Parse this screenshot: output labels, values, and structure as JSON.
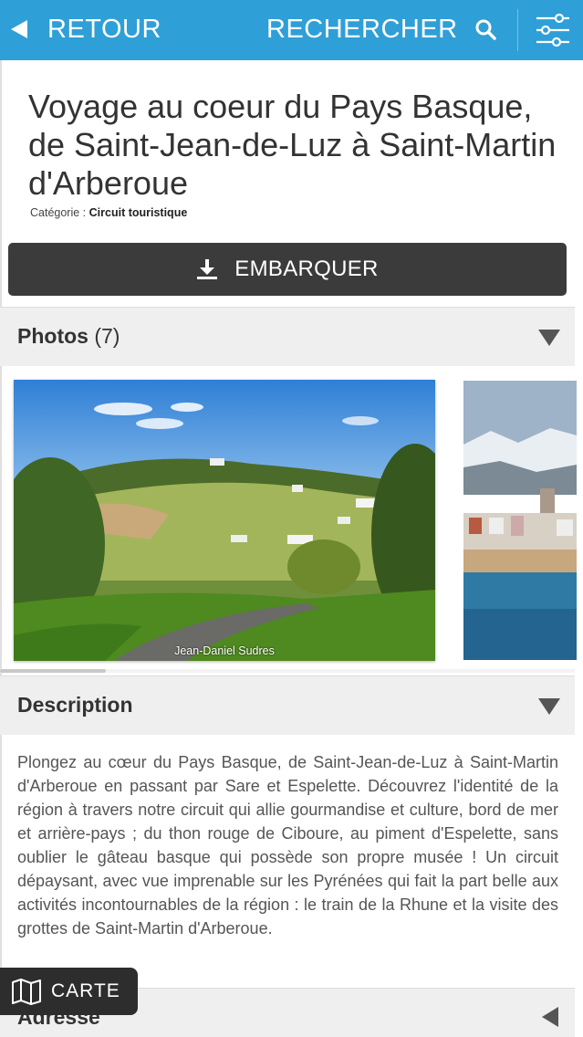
{
  "topbar": {
    "back_label": "RETOUR",
    "search_label": "RECHERCHER"
  },
  "poi": {
    "title_lines": [
      "Voyage au coeur du Pays Basque,",
      "de Saint-Jean-de-Luz à Saint-Martin",
      "d'Arberoue"
    ],
    "category_prefix": "Catégorie :",
    "category": "Circuit touristique"
  },
  "embark": {
    "label": "EMBARQUER"
  },
  "photos": {
    "label": "Photos",
    "count": "(7)",
    "items": [
      {
        "credit": "Jean-Daniel Sudres"
      }
    ]
  },
  "description": {
    "label": "Description",
    "text": "Plongez au cœur du Pays Basque, de Saint-Jean-de-Luz à Saint-Martin d'Arberoue en passant par Sare et Espelette. Découvrez l'identité de la région à travers notre circuit qui allie gourmandise et culture, bord de mer et arrière-pays ; du thon rouge de Ciboure, au piment d'Espelette, sans oublier le gâteau basque qui possède son propre musée ! Un circuit dépaysant, avec vue imprenable sur les Pyrénées qui fait la part belle aux activités incontournables de la région : le train de la Rhune et la visite des grottes de Saint-Martin d'Arberoue."
  },
  "address": {
    "label": "Adresse"
  },
  "map_button": {
    "label": "CARTE"
  },
  "colors": {
    "topbar": "#2f9fd7",
    "embark_button": "#3b3b3c",
    "section_header": "#efefef"
  }
}
